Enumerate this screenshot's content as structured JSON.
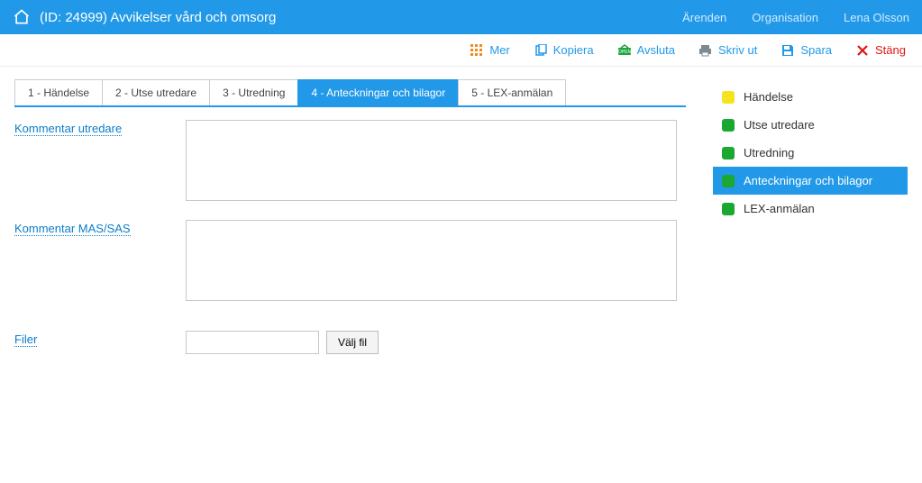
{
  "header": {
    "title": "(ID: 24999) Avvikelser vård och omsorg",
    "links": {
      "arenden": "Ärenden",
      "organisation": "Organisation",
      "user": "Lena Olsson"
    }
  },
  "toolbar": {
    "mer": "Mer",
    "kopiera": "Kopiera",
    "avsluta": "Avsluta",
    "skrivut": "Skriv ut",
    "spara": "Spara",
    "stang": "Stäng"
  },
  "tabs": [
    {
      "label": "1 - Händelse",
      "active": false
    },
    {
      "label": "2 - Utse utredare",
      "active": false
    },
    {
      "label": "3 - Utredning",
      "active": false
    },
    {
      "label": "4 - Anteckningar och bilagor",
      "active": true
    },
    {
      "label": "5 - LEX-anmälan",
      "active": false
    }
  ],
  "form": {
    "kommentar_utredare_label": "Kommentar utredare",
    "kommentar_utredare_value": "",
    "kommentar_massas_label": "Kommentar MAS/SAS",
    "kommentar_massas_value": "",
    "filer_label": "Filer",
    "filer_value": "",
    "valj_fil_button": "Välj fil"
  },
  "side": [
    {
      "label": "Händelse",
      "status": "yellow",
      "active": false
    },
    {
      "label": "Utse utredare",
      "status": "green",
      "active": false
    },
    {
      "label": "Utredning",
      "status": "green",
      "active": false
    },
    {
      "label": "Anteckningar och bilagor",
      "status": "green",
      "active": true
    },
    {
      "label": "LEX-anmälan",
      "status": "green",
      "active": false
    }
  ]
}
